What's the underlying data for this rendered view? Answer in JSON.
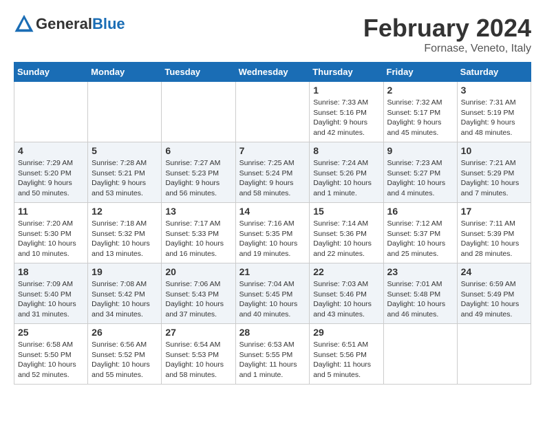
{
  "header": {
    "logo_general": "General",
    "logo_blue": "Blue",
    "month_title": "February 2024",
    "subtitle": "Fornase, Veneto, Italy"
  },
  "weekdays": [
    "Sunday",
    "Monday",
    "Tuesday",
    "Wednesday",
    "Thursday",
    "Friday",
    "Saturday"
  ],
  "weeks": [
    [
      {
        "day": "",
        "info": ""
      },
      {
        "day": "",
        "info": ""
      },
      {
        "day": "",
        "info": ""
      },
      {
        "day": "",
        "info": ""
      },
      {
        "day": "1",
        "info": "Sunrise: 7:33 AM\nSunset: 5:16 PM\nDaylight: 9 hours\nand 42 minutes."
      },
      {
        "day": "2",
        "info": "Sunrise: 7:32 AM\nSunset: 5:17 PM\nDaylight: 9 hours\nand 45 minutes."
      },
      {
        "day": "3",
        "info": "Sunrise: 7:31 AM\nSunset: 5:19 PM\nDaylight: 9 hours\nand 48 minutes."
      }
    ],
    [
      {
        "day": "4",
        "info": "Sunrise: 7:29 AM\nSunset: 5:20 PM\nDaylight: 9 hours\nand 50 minutes."
      },
      {
        "day": "5",
        "info": "Sunrise: 7:28 AM\nSunset: 5:21 PM\nDaylight: 9 hours\nand 53 minutes."
      },
      {
        "day": "6",
        "info": "Sunrise: 7:27 AM\nSunset: 5:23 PM\nDaylight: 9 hours\nand 56 minutes."
      },
      {
        "day": "7",
        "info": "Sunrise: 7:25 AM\nSunset: 5:24 PM\nDaylight: 9 hours\nand 58 minutes."
      },
      {
        "day": "8",
        "info": "Sunrise: 7:24 AM\nSunset: 5:26 PM\nDaylight: 10 hours\nand 1 minute."
      },
      {
        "day": "9",
        "info": "Sunrise: 7:23 AM\nSunset: 5:27 PM\nDaylight: 10 hours\nand 4 minutes."
      },
      {
        "day": "10",
        "info": "Sunrise: 7:21 AM\nSunset: 5:29 PM\nDaylight: 10 hours\nand 7 minutes."
      }
    ],
    [
      {
        "day": "11",
        "info": "Sunrise: 7:20 AM\nSunset: 5:30 PM\nDaylight: 10 hours\nand 10 minutes."
      },
      {
        "day": "12",
        "info": "Sunrise: 7:18 AM\nSunset: 5:32 PM\nDaylight: 10 hours\nand 13 minutes."
      },
      {
        "day": "13",
        "info": "Sunrise: 7:17 AM\nSunset: 5:33 PM\nDaylight: 10 hours\nand 16 minutes."
      },
      {
        "day": "14",
        "info": "Sunrise: 7:16 AM\nSunset: 5:35 PM\nDaylight: 10 hours\nand 19 minutes."
      },
      {
        "day": "15",
        "info": "Sunrise: 7:14 AM\nSunset: 5:36 PM\nDaylight: 10 hours\nand 22 minutes."
      },
      {
        "day": "16",
        "info": "Sunrise: 7:12 AM\nSunset: 5:37 PM\nDaylight: 10 hours\nand 25 minutes."
      },
      {
        "day": "17",
        "info": "Sunrise: 7:11 AM\nSunset: 5:39 PM\nDaylight: 10 hours\nand 28 minutes."
      }
    ],
    [
      {
        "day": "18",
        "info": "Sunrise: 7:09 AM\nSunset: 5:40 PM\nDaylight: 10 hours\nand 31 minutes."
      },
      {
        "day": "19",
        "info": "Sunrise: 7:08 AM\nSunset: 5:42 PM\nDaylight: 10 hours\nand 34 minutes."
      },
      {
        "day": "20",
        "info": "Sunrise: 7:06 AM\nSunset: 5:43 PM\nDaylight: 10 hours\nand 37 minutes."
      },
      {
        "day": "21",
        "info": "Sunrise: 7:04 AM\nSunset: 5:45 PM\nDaylight: 10 hours\nand 40 minutes."
      },
      {
        "day": "22",
        "info": "Sunrise: 7:03 AM\nSunset: 5:46 PM\nDaylight: 10 hours\nand 43 minutes."
      },
      {
        "day": "23",
        "info": "Sunrise: 7:01 AM\nSunset: 5:48 PM\nDaylight: 10 hours\nand 46 minutes."
      },
      {
        "day": "24",
        "info": "Sunrise: 6:59 AM\nSunset: 5:49 PM\nDaylight: 10 hours\nand 49 minutes."
      }
    ],
    [
      {
        "day": "25",
        "info": "Sunrise: 6:58 AM\nSunset: 5:50 PM\nDaylight: 10 hours\nand 52 minutes."
      },
      {
        "day": "26",
        "info": "Sunrise: 6:56 AM\nSunset: 5:52 PM\nDaylight: 10 hours\nand 55 minutes."
      },
      {
        "day": "27",
        "info": "Sunrise: 6:54 AM\nSunset: 5:53 PM\nDaylight: 10 hours\nand 58 minutes."
      },
      {
        "day": "28",
        "info": "Sunrise: 6:53 AM\nSunset: 5:55 PM\nDaylight: 11 hours\nand 1 minute."
      },
      {
        "day": "29",
        "info": "Sunrise: 6:51 AM\nSunset: 5:56 PM\nDaylight: 11 hours\nand 5 minutes."
      },
      {
        "day": "",
        "info": ""
      },
      {
        "day": "",
        "info": ""
      }
    ]
  ]
}
